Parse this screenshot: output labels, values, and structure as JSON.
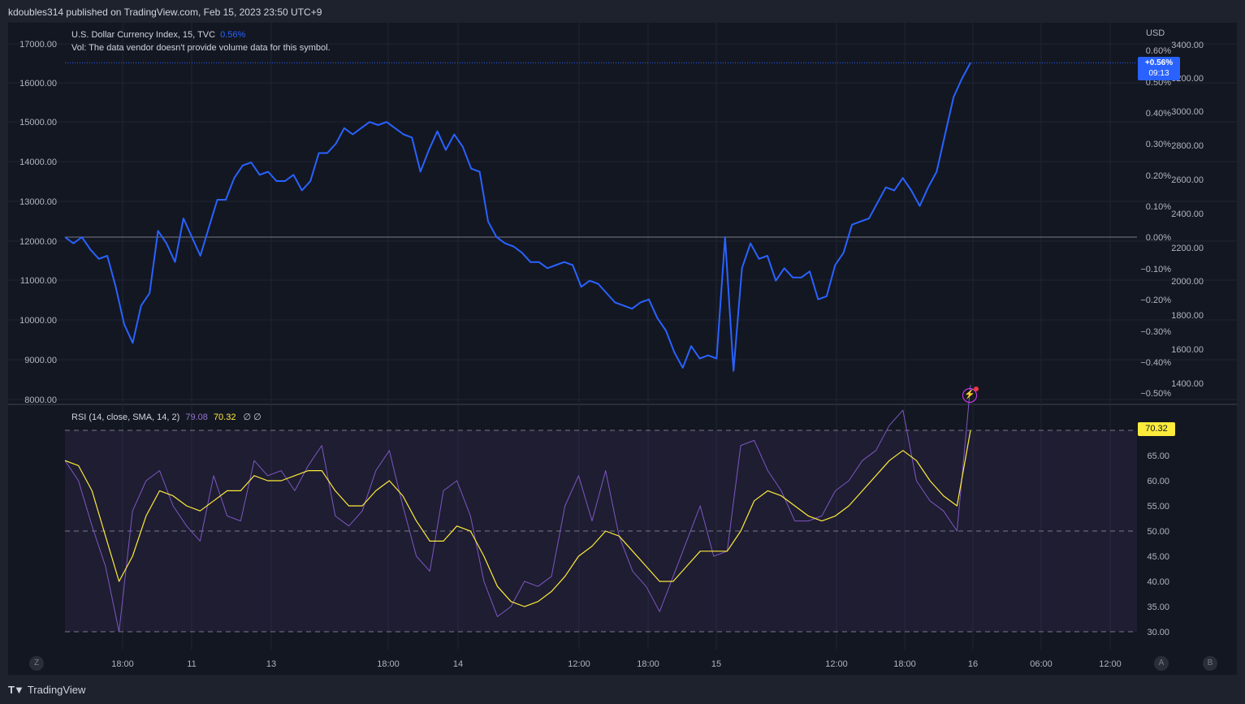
{
  "header": {
    "published": "kdoubles314 published on TradingView.com, Feb 15, 2023 23:50 UTC+9"
  },
  "legend": {
    "symbol": "U.S. Dollar Currency Index, 15, TVC",
    "change": "0.56%",
    "volume_note": "Vol: The data vendor doesn't provide volume data for this symbol."
  },
  "rsi_legend": {
    "label": "RSI (14, close, SMA, 14, 2)",
    "rsi_value": "79.08",
    "sma_value": "70.32",
    "extra": "∅ ∅"
  },
  "badges": {
    "price_change": "+0.56%",
    "countdown": "09:13",
    "rsi": "70.32"
  },
  "axes": {
    "left_ticks": [
      "17000.00",
      "16000.00",
      "15000.00",
      "14000.00",
      "13000.00",
      "12000.00",
      "11000.00",
      "10000.00",
      "9000.00",
      "8000.00"
    ],
    "pct_unit": "USD",
    "pct_ticks": [
      "0.60%",
      "0.50%",
      "0.40%",
      "0.30%",
      "0.20%",
      "0.10%",
      "0.00%",
      "−0.10%",
      "−0.20%",
      "−0.30%",
      "−0.40%",
      "−0.50%"
    ],
    "right_ticks": [
      "3400.00",
      "3200.00",
      "3000.00",
      "2800.00",
      "2600.00",
      "2400.00",
      "2200.00",
      "2000.00",
      "1800.00",
      "1600.00",
      "1400.00"
    ],
    "rsi_ticks": [
      "65.00",
      "60.00",
      "55.00",
      "50.00",
      "45.00",
      "40.00",
      "35.00",
      "30.00"
    ],
    "time_ticks": [
      "18:00",
      "11",
      "13",
      "18:00",
      "14",
      "12:00",
      "18:00",
      "15",
      "12:00",
      "18:00",
      "16",
      "06:00",
      "12:00"
    ]
  },
  "buttons": {
    "z": "Z",
    "a": "A",
    "b": "B"
  },
  "footer": {
    "brand": "TradingView"
  },
  "colors": {
    "price_line": "#2962ff",
    "rsi_line": "#7e57c2",
    "rsi_sma": "#ffeb3b",
    "background": "#131722"
  },
  "chart_data": [
    {
      "type": "line",
      "title": "U.S. Dollar Currency Index, 15, TVC",
      "ylabel": "USD",
      "ylim": [
        -0.5,
        0.6
      ],
      "x_labels": [
        "18:00",
        "11",
        "13",
        "18:00",
        "14",
        "12:00",
        "18:00",
        "15",
        "12:00",
        "18:00",
        "16",
        "06:00",
        "12:00"
      ],
      "series": [
        {
          "name": "U.S. Dollar Currency Index",
          "values": [
            0.0,
            -0.02,
            0.0,
            -0.04,
            -0.07,
            -0.06,
            -0.16,
            -0.28,
            -0.34,
            -0.22,
            -0.18,
            0.02,
            -0.02,
            -0.08,
            0.06,
            0.0,
            -0.06,
            0.03,
            0.12,
            0.12,
            0.19,
            0.23,
            0.24,
            0.2,
            0.21,
            0.18,
            0.18,
            0.2,
            0.15,
            0.18,
            0.27,
            0.27,
            0.3,
            0.35,
            0.33,
            0.35,
            0.37,
            0.36,
            0.37,
            0.35,
            0.33,
            0.32,
            0.21,
            0.28,
            0.34,
            0.28,
            0.33,
            0.29,
            0.22,
            0.21,
            0.05,
            0.0,
            -0.02,
            -0.03,
            -0.05,
            -0.08,
            -0.08,
            -0.1,
            -0.09,
            -0.08,
            -0.09,
            -0.16,
            -0.14,
            -0.15,
            -0.18,
            -0.21,
            -0.22,
            -0.23,
            -0.21,
            -0.2,
            -0.26,
            -0.3,
            -0.37,
            -0.42,
            -0.35,
            -0.39,
            -0.38,
            -0.39,
            0.0,
            -0.43,
            -0.1,
            -0.02,
            -0.07,
            -0.06,
            -0.14,
            -0.1,
            -0.13,
            -0.13,
            -0.11,
            -0.2,
            -0.19,
            -0.09,
            -0.05,
            0.04,
            0.05,
            0.06,
            0.11,
            0.16,
            0.15,
            0.19,
            0.15,
            0.1,
            0.16,
            0.21,
            0.33,
            0.45,
            0.51,
            0.56
          ]
        }
      ]
    },
    {
      "type": "line",
      "title": "RSI (14, close, SMA, 14, 2)",
      "ylim": [
        30,
        65
      ],
      "series": [
        {
          "name": "RSI",
          "values": [
            64,
            60,
            51,
            43,
            30,
            54,
            60,
            62,
            55,
            51,
            48,
            61,
            53,
            52,
            64,
            61,
            62,
            58,
            63,
            67,
            53,
            51,
            54,
            62,
            66,
            55,
            45,
            42,
            58,
            60,
            53,
            40,
            33,
            35,
            40,
            39,
            41,
            55,
            61,
            52,
            62,
            49,
            42,
            39,
            34,
            41,
            48,
            55,
            45,
            46,
            67,
            68,
            62,
            58,
            52,
            52,
            53,
            58,
            60,
            64,
            66,
            71,
            74,
            60,
            56,
            54,
            50,
            79
          ]
        },
        {
          "name": "RSI-based MA",
          "values": [
            64,
            63,
            58,
            49,
            40,
            45,
            53,
            58,
            57,
            55,
            54,
            56,
            58,
            58,
            61,
            60,
            60,
            61,
            62,
            62,
            58,
            55,
            55,
            58,
            60,
            57,
            52,
            48,
            48,
            51,
            50,
            45,
            39,
            36,
            35,
            36,
            38,
            41,
            45,
            47,
            50,
            49,
            46,
            43,
            40,
            40,
            43,
            46,
            46,
            46,
            50,
            56,
            58,
            57,
            55,
            53,
            52,
            53,
            55,
            58,
            61,
            64,
            66,
            64,
            60,
            57,
            55,
            70
          ]
        }
      ]
    }
  ]
}
